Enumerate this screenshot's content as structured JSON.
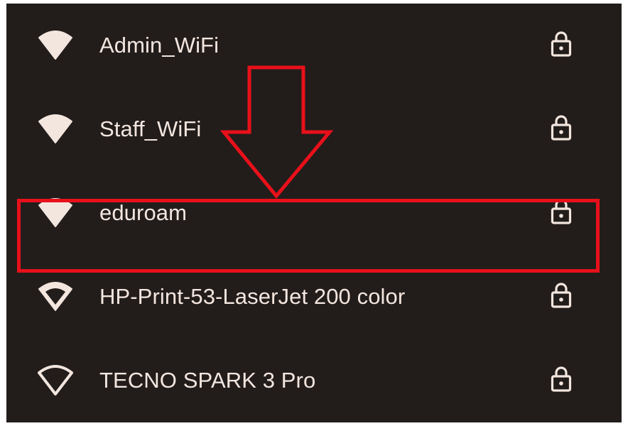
{
  "networks": [
    {
      "ssid": "Admin_WiFi",
      "icon": "wifi-signal-icon",
      "secured": true
    },
    {
      "ssid": "Staff_WiFi",
      "icon": "wifi-signal-icon",
      "secured": true
    },
    {
      "ssid": "eduroam",
      "icon": "wifi-signal-icon",
      "secured": true,
      "highlighted": true
    },
    {
      "ssid": "HP-Print-53-LaserJet 200 color",
      "icon": "wifi-signal-icon",
      "secured": true
    },
    {
      "ssid": "TECNO SPARK 3 Pro",
      "icon": "wifi-signal-icon",
      "secured": true
    }
  ],
  "colors": {
    "background": "#221d1b",
    "text": "#f3e6df",
    "icon": "#f3e6df",
    "annotation": "#e8101a"
  },
  "annotation": {
    "type": "arrow-and-box",
    "target": "eduroam"
  }
}
